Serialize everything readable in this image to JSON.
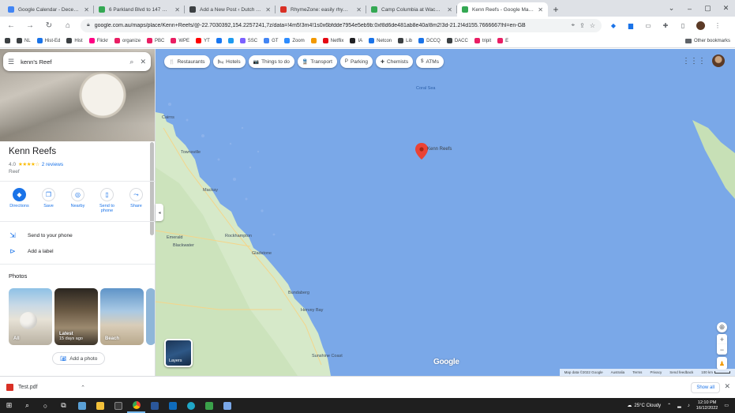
{
  "browser": {
    "tabs": [
      {
        "title": "Google Calendar - December",
        "color": "#4285f4"
      },
      {
        "title": "6 Parkland Blvd to 147 Oldfield",
        "color": "#34a853"
      },
      {
        "title": "Add a New Post ‹ Dutch Austra",
        "color": "#3c4043"
      },
      {
        "title": "RhymeZone: easily rhymes",
        "color": "#d93025"
      },
      {
        "title": "Camp Columbia at Wacol – Q",
        "color": "#34a853"
      },
      {
        "title": "Kenn Reefs - Google Maps",
        "color": "#34a853"
      }
    ],
    "active_tab_index": 5,
    "url": "google.com.au/maps/place/Kenn+Reefs/@-22.7030392,154.2257241,7z/data=!4m5!3m4!1s0x6bfdde7954e5eb9b:0xf8d6de481ab8e40a!8m2!3d-21.2!4d155.7666667!hl=en-GB",
    "bookmarks": [
      {
        "label": "",
        "color": "#3c4043"
      },
      {
        "label": "NL",
        "color": "#3c4043"
      },
      {
        "label": "Hist-Ed",
        "color": "#1a73e8"
      },
      {
        "label": "Hist",
        "color": "#3c4043"
      },
      {
        "label": "Flickr",
        "color": "#ff0084"
      },
      {
        "label": "organize",
        "color": "#e91e63"
      },
      {
        "label": "PBC",
        "color": "#e91e63"
      },
      {
        "label": "WPE",
        "color": "#e91e63"
      },
      {
        "label": "YT",
        "color": "#ff0000"
      },
      {
        "label": "",
        "color": "#1877f2"
      },
      {
        "label": "",
        "color": "#1d9bf0"
      },
      {
        "label": "SSC",
        "color": "#7b61ff"
      },
      {
        "label": "GT",
        "color": "#4285f4"
      },
      {
        "label": "Zoom",
        "color": "#2d8cff"
      },
      {
        "label": "",
        "color": "#f29900"
      },
      {
        "label": "Netflix",
        "color": "#e50914"
      },
      {
        "label": "IA",
        "color": "#202124"
      },
      {
        "label": "Netcon",
        "color": "#1a73e8"
      },
      {
        "label": "Lib",
        "color": "#3c4043"
      },
      {
        "label": "DCCQ",
        "color": "#1a73e8"
      },
      {
        "label": "DACC",
        "color": "#3c4043"
      },
      {
        "label": "tripit",
        "color": "#e91e63"
      },
      {
        "label": "E",
        "color": "#e91e63"
      }
    ],
    "other_bookmarks": "Other bookmarks"
  },
  "panel": {
    "search_value": "kenn's Reef",
    "place_name": "Kenn Reefs",
    "rating": "4.0",
    "stars": "★★★★☆",
    "reviews": "2 reviews",
    "place_type": "Reef",
    "actions": [
      {
        "label": "Directions",
        "icon": "◆",
        "name": "directions"
      },
      {
        "label": "Save",
        "icon": "❐",
        "name": "save"
      },
      {
        "label": "Nearby",
        "icon": "◎",
        "name": "nearby"
      },
      {
        "label": "Send to phone",
        "icon": "▯",
        "name": "send-to-phone"
      },
      {
        "label": "Share",
        "icon": "⤳",
        "name": "share"
      }
    ],
    "send_to_phone": "Send to your phone",
    "add_label": "Add a label",
    "photos_heading": "Photos",
    "photos": [
      {
        "caption": "All",
        "sub": ""
      },
      {
        "caption": "Latest",
        "sub": "15 days ago"
      },
      {
        "caption": "Beach",
        "sub": ""
      }
    ],
    "add_photo": "Add a photo"
  },
  "map": {
    "chips": [
      {
        "label": "Restaurants",
        "icon": "🍴"
      },
      {
        "label": "Hotels",
        "icon": "🛏"
      },
      {
        "label": "Things to do",
        "icon": "📷"
      },
      {
        "label": "Transport",
        "icon": "🚆"
      },
      {
        "label": "Parking",
        "icon": "P"
      },
      {
        "label": "Chemists",
        "icon": "✚"
      },
      {
        "label": "ATMs",
        "icon": "$"
      }
    ],
    "marker_label": "Kenn Reefs",
    "sea_label": "Coral Sea",
    "places": [
      "Cairns",
      "Townsville",
      "Mackay",
      "Rockhampton",
      "Bundaberg",
      "Sunshine Coast",
      "Emerald",
      "Blackwater",
      "Gladstone",
      "Hervey Bay"
    ],
    "layers_label": "Layers",
    "logo": "Google",
    "footer": [
      "Map data ©2022 Google",
      "Australia",
      "Terms",
      "Privacy",
      "Send feedback",
      "100 km"
    ],
    "accent": "#1a73e8",
    "sea_color": "#7aa8e8",
    "land_color": "#d6e9c9"
  },
  "downloads": {
    "file": "Test.pdf",
    "show_all": "Show all"
  },
  "taskbar": {
    "weather": "25°C  Cloudy",
    "time": "12:10 PM",
    "date": "16/12/2022"
  }
}
